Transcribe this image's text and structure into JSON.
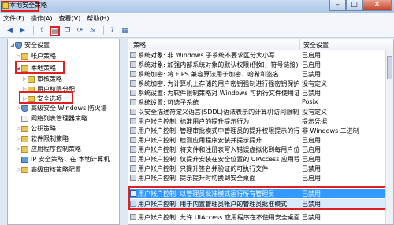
{
  "window": {
    "title": "本地安全策略"
  },
  "menu": [
    "文件(F)",
    "操作(A)",
    "查看(V)",
    "帮助(H)"
  ],
  "toolbar": {
    "buttons": [
      "back-icon",
      "forward-icon",
      "folder-up-icon",
      "show-tree-icon",
      "copy-icon",
      "refresh-icon",
      "export-icon",
      "help-icon",
      "properties-icon"
    ]
  },
  "tree": {
    "items": [
      {
        "label": "安全设置",
        "icon": "shield",
        "indent": 0
      },
      {
        "label": "帐户策略",
        "icon": "folder",
        "indent": 1
      },
      {
        "label": "本地策略",
        "icon": "folder",
        "indent": 1
      },
      {
        "label": "审核策略",
        "icon": "folder",
        "indent": 2
      },
      {
        "label": "用户权限分配",
        "icon": "folder",
        "indent": 2
      },
      {
        "label": "安全选项",
        "icon": "folder",
        "indent": 2
      },
      {
        "label": "高级安全 Windows 防火墙",
        "icon": "shield",
        "indent": 1
      },
      {
        "label": "网络列表管理器策略",
        "icon": "doc",
        "indent": 1
      },
      {
        "label": "公钥策略",
        "icon": "folder",
        "indent": 1
      },
      {
        "label": "软件限制策略",
        "icon": "folder",
        "indent": 1
      },
      {
        "label": "应用程序控制策略",
        "icon": "folder",
        "indent": 1
      },
      {
        "label": "IP 安全策略，在 本地计算机",
        "icon": "net",
        "indent": 1
      },
      {
        "label": "高级审核策略配置",
        "icon": "folder",
        "indent": 1
      }
    ]
  },
  "list": {
    "columns": [
      "策略",
      "安全设置"
    ],
    "rows": [
      {
        "name": "系统对象: 非 Windows 子系统不要求区分大小写",
        "value": "已启用"
      },
      {
        "name": "系统对象: 加强内部系统对象的默认权限(例如，符号链接)",
        "value": "已启用"
      },
      {
        "name": "系统加密: 将 FIPS 兼容算法用于加密、哈希和签名",
        "value": "已禁用"
      },
      {
        "name": "系统加密: 为计算机上存储的用户密钥强制进行强密钥保护",
        "value": "没有定义"
      },
      {
        "name": "系统设置: 为软件限制策略对 Windows 可执行文件使用证书规则",
        "value": "已禁用"
      },
      {
        "name": "系统设置: 可选子系统",
        "value": "Posix"
      },
      {
        "name": "以安全描述符定义语言(SDDL)语法表示的计算机访问限制",
        "value": "没有定义"
      },
      {
        "name": "用户帐户控制: 标准用户的提升提示行为",
        "value": "提示凭据"
      },
      {
        "name": "用户帐户控制: 管理审批模式中管理员的提升权限提示的行为",
        "value": "非 Windows 二进制"
      },
      {
        "name": "用户帐户控制: 检测应用程序安装并提示提升",
        "value": "已启用"
      },
      {
        "name": "用户帐户控制: 将文件和注册表写入错误虚拟化到每用户位置",
        "value": "已启用"
      },
      {
        "name": "用户帐户控制: 仅提升安装在安全位置的 UIAccess 应用程序",
        "value": "已启用"
      },
      {
        "name": "用户帐户控制: 只提升签名并验证的可执行文件",
        "value": "已禁用"
      },
      {
        "name": "用户帐户控制: 提示提升时切换到安全桌面",
        "value": "已启用"
      },
      {
        "name": "用户帐户控制: 以管理员批准模式运行所有管理员",
        "value": "已禁用"
      },
      {
        "name": "用户帐户控制: 用于内置管理员帐户的管理员批准模式",
        "value": "已禁用"
      },
      {
        "name": "用户帐户控制: 允许 UIAccess 应用程序在不使用安全桌面的情况...",
        "value": "已禁用"
      }
    ]
  }
}
